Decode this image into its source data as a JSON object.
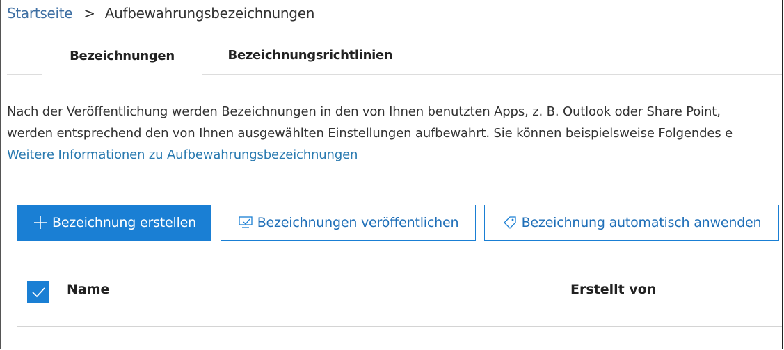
{
  "breadcrumb": {
    "home": "Startseite",
    "separator": ">",
    "current": "Aufbewahrungsbezeichnungen"
  },
  "tabs": [
    {
      "label": "Bezeichnungen",
      "active": true
    },
    {
      "label": "Bezeichnungsrichtlinien",
      "active": false
    }
  ],
  "description": {
    "line1": "Nach der Veröffentlichung werden Bezeichnungen in den von Ihnen benutzten Apps, z. B. Outlook oder Share Point,",
    "line2": "werden entsprechend den von Ihnen ausgewählten Einstellungen aufbewahrt. Sie können beispielsweise Folgendes e",
    "link": "Weitere Informationen zu Aufbewahrungsbezeichnungen"
  },
  "toolbar": {
    "create_label": "Bezeichnung erstellen",
    "create_icon": "plus-icon",
    "publish_label": "Bezeichnungen veröffentlichen",
    "publish_icon": "publish-icon",
    "auto_label": "Bezeichnung automatisch anwenden",
    "auto_icon": "tag-icon"
  },
  "table": {
    "select_all_checked": true,
    "columns": [
      "Name",
      "Erstellt von"
    ]
  },
  "colors": {
    "accent": "#1a7fd4",
    "link": "#2a7ab0"
  }
}
